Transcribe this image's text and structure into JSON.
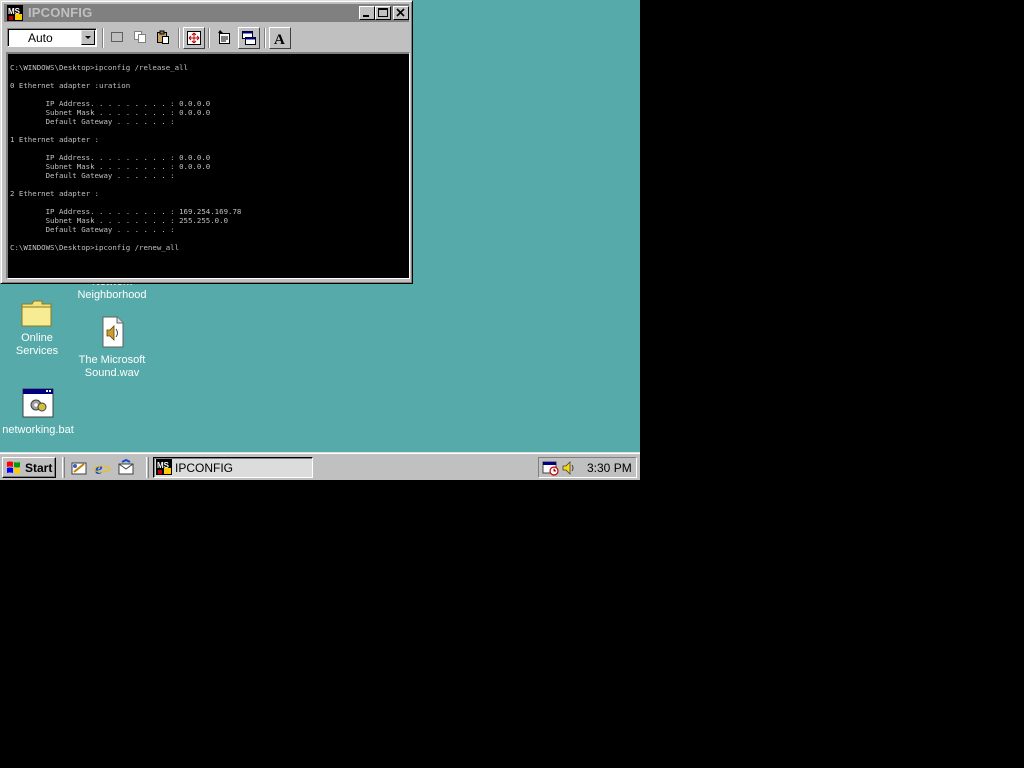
{
  "window": {
    "title": "IPCONFIG",
    "font_select": "Auto",
    "console_lines": [
      "C:\\WINDOWS\\Desktop>ipconfig /release_all",
      "",
      "0 Ethernet adapter :uration",
      "",
      "        IP Address. . . . . . . . . : 0.0.0.0",
      "        Subnet Mask . . . . . . . . : 0.0.0.0",
      "        Default Gateway . . . . . . :",
      "",
      "1 Ethernet adapter :",
      "",
      "        IP Address. . . . . . . . . : 0.0.0.0",
      "        Subnet Mask . . . . . . . . : 0.0.0.0",
      "        Default Gateway . . . . . . :",
      "",
      "2 Ethernet adapter :",
      "",
      "        IP Address. . . . . . . . . : 169.254.169.78",
      "        Subnet Mask . . . . . . . . : 255.255.0.0",
      "        Default Gateway . . . . . . :",
      "",
      "C:\\WINDOWS\\Desktop>ipconfig /renew_all"
    ]
  },
  "desktop": {
    "icons": {
      "network": "Network Neighborhood",
      "online_services": "Online Services",
      "sound": "The Microsoft Sound.wav",
      "networking_bat": "networking.bat"
    }
  },
  "taskbar": {
    "start_label": "Start",
    "task_label": "IPCONFIG",
    "clock": "3:30 PM"
  },
  "colors": {
    "desktop": "#56aaaa",
    "title_inactive": "#808080",
    "face": "#c0c0c0"
  }
}
